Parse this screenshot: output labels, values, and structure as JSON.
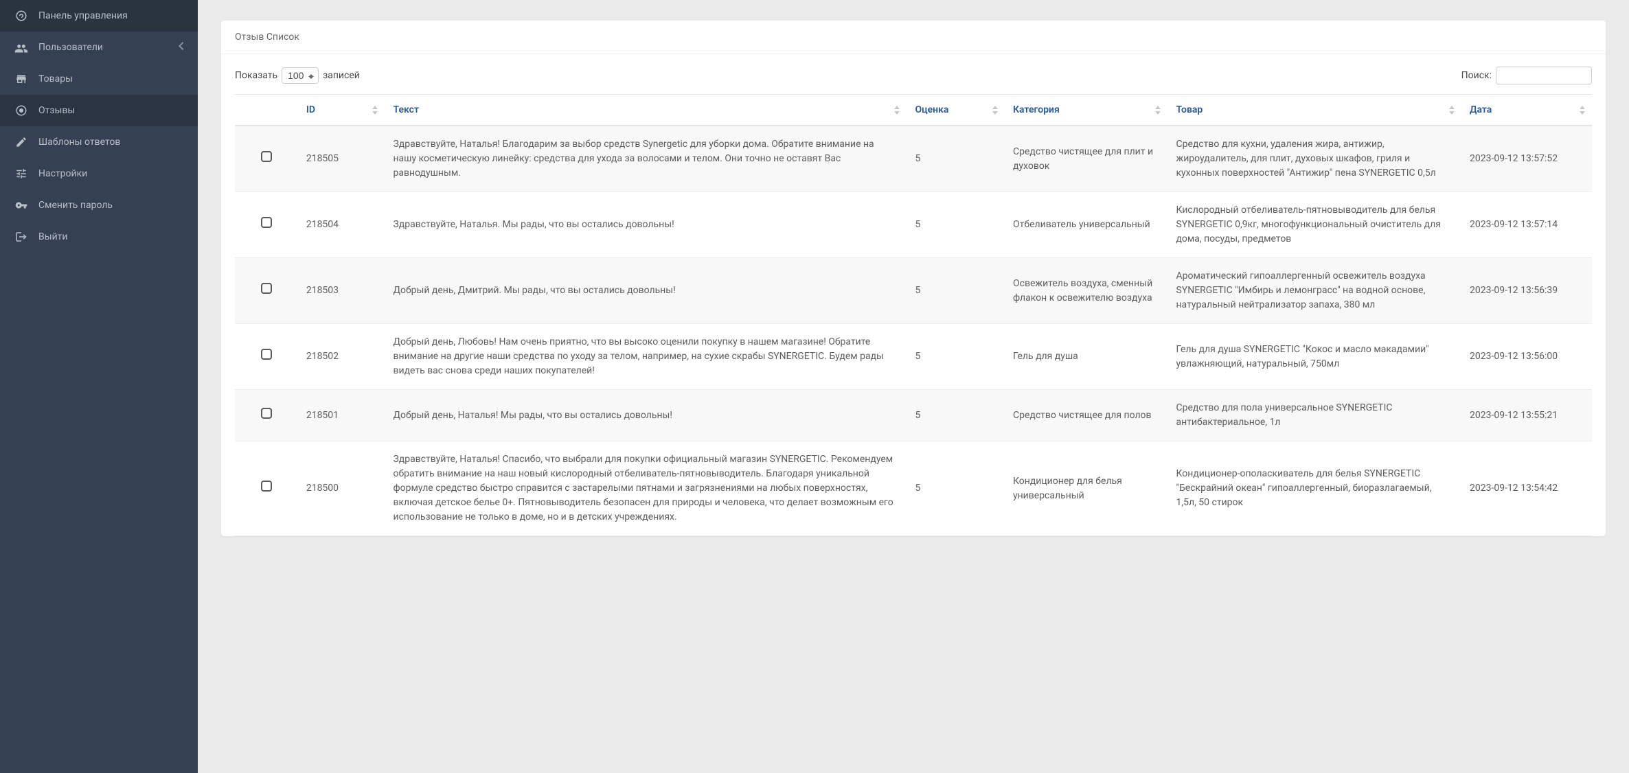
{
  "sidebar": {
    "items": [
      {
        "label": "Панель управления",
        "icon": "dashboard-icon",
        "hasChevron": false
      },
      {
        "label": "Пользователи",
        "icon": "users-icon",
        "hasChevron": true
      },
      {
        "label": "Товары",
        "icon": "store-icon",
        "hasChevron": false
      },
      {
        "label": "Отзывы",
        "icon": "target-icon",
        "hasChevron": false,
        "active": true
      },
      {
        "label": "Шаблоны ответов",
        "icon": "pencil-icon",
        "hasChevron": false
      },
      {
        "label": "Настройки",
        "icon": "sliders-icon",
        "hasChevron": false
      },
      {
        "label": "Сменить пароль",
        "icon": "key-icon",
        "hasChevron": false
      },
      {
        "label": "Выйти",
        "icon": "signout-icon",
        "hasChevron": false
      }
    ]
  },
  "card": {
    "title": "Отзыв Список"
  },
  "table": {
    "lengthPrefix": "Показать",
    "lengthSuffix": "записей",
    "lengthValue": "100",
    "searchLabel": "Поиск:",
    "columns": [
      "",
      "ID",
      "Текст",
      "Оценка",
      "Категория",
      "Товар",
      "Дата"
    ],
    "rows": [
      {
        "id": "218505",
        "text": "Здравствуйте, Наталья! Благодарим за выбор средств Synergetic для уборки дома. Обратите внимание на нашу косметическую линейку: средства для ухода за волосами и телом. Они точно не оставят Вас равнодушным.",
        "rating": "5",
        "category": "Средство чистящее для плит и духовок",
        "product": "Средство для кухни, удаления жира, антижир, жироудалитель, для плит, духовых шкафов, гриля и кухонных поверхностей \"Антижир\" пена SYNERGETIC 0,5л",
        "date": "2023-09-12 13:57:52"
      },
      {
        "id": "218504",
        "text": "Здравствуйте, Наталья. Мы рады, что вы остались довольны!",
        "rating": "5",
        "category": "Отбеливатель универсальный",
        "product": "Кислородный отбеливатель-пятновыводитель для белья SYNERGETIC 0,9кг, многофункциональный очиститель для дома, посуды, предметов",
        "date": "2023-09-12 13:57:14"
      },
      {
        "id": "218503",
        "text": "Добрый день, Дмитрий. Мы рады, что вы остались довольны!",
        "rating": "5",
        "category": "Освежитель воздуха, сменный флакон к освежителю воздуха",
        "product": "Ароматический гипоаллергенный освежитель воздуха SYNERGETIC \"Имбирь и лемонграсс\" на водной основе, натуральный нейтрализатор запаха, 380 мл",
        "date": "2023-09-12 13:56:39"
      },
      {
        "id": "218502",
        "text": "Добрый день, Любовь! Нам очень приятно, что вы высоко оценили покупку в нашем магазине! Обратите внимание на другие наши средства по уходу за телом, например, на сухие скрабы SYNERGETIC. Будем рады видеть вас снова среди наших покупателей!",
        "rating": "5",
        "category": "Гель для душа",
        "product": "Гель для душа SYNERGETIC \"Кокос и масло макадамии\" увлажняющий, натуральный, 750мл",
        "date": "2023-09-12 13:56:00"
      },
      {
        "id": "218501",
        "text": "Добрый день, Наталья! Мы рады, что вы остались довольны!",
        "rating": "5",
        "category": "Средство чистящее для полов",
        "product": "Средство для пола универсальное SYNERGETIC антибактериальное, 1л",
        "date": "2023-09-12 13:55:21"
      },
      {
        "id": "218500",
        "text": "Здравствуйте, Наталья! Спасибо, что выбрали для покупки официальный магазин SYNERGETIC. Рекомендуем обратить внимание на наш новый кислородный отбеливатель-пятновыводитель. Благодаря уникальной формуле средство быстро справится с застарелыми пятнами и загрязнениями на любых поверхностях, включая детское белье 0+. Пятновыводитель безопасен для природы и человека, что делает возможным его использование не только в доме, но и в детских учреждениях.",
        "rating": "5",
        "category": "Кондиционер для белья универсальный",
        "product": "Кондиционер-ополаскиватель для белья SYNERGETIC \"Бескрайний океан\" гипоаллергенный, биоразлагаемый, 1,5л, 50 стирок",
        "date": "2023-09-12 13:54:42"
      }
    ]
  }
}
